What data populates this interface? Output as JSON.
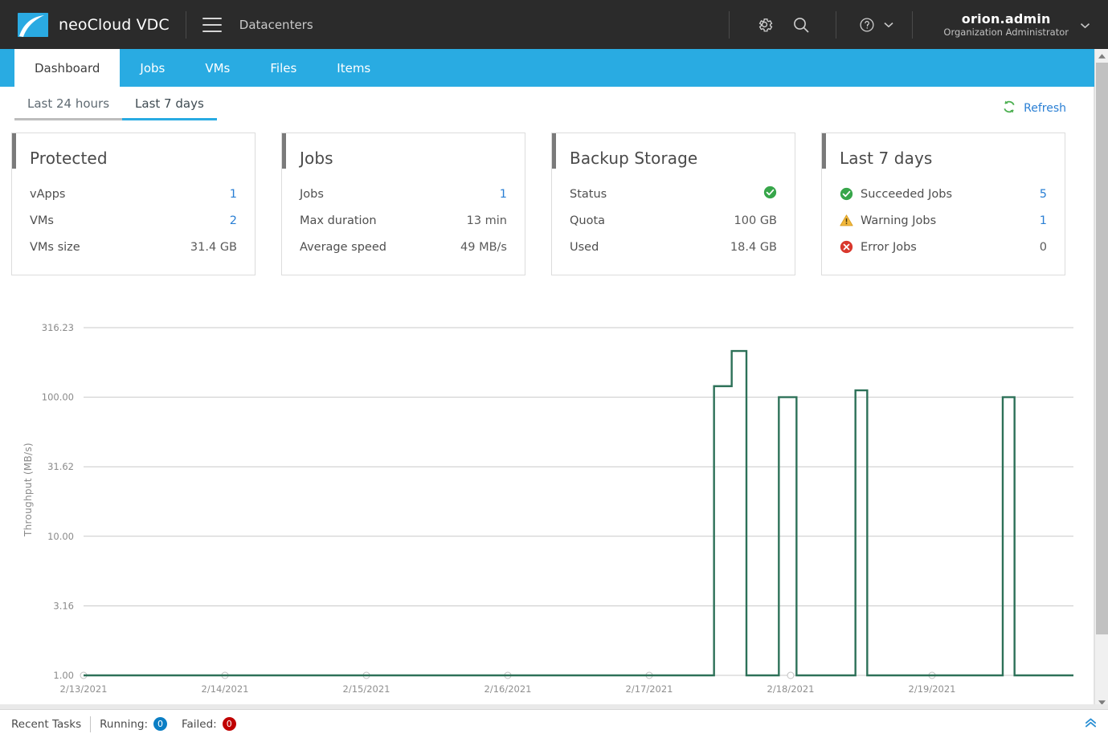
{
  "header": {
    "brand": "neoCloud VDC",
    "breadcrumb": "Datacenters",
    "menu_icon": "hamburger-icon",
    "settings_icon": "gear-icon",
    "search_icon": "search-icon",
    "help_icon": "help-circle-icon",
    "user_name": "orion.admin",
    "user_role": "Organization Administrator"
  },
  "tabs": [
    {
      "label": "Dashboard",
      "active": true
    },
    {
      "label": "Jobs",
      "active": false
    },
    {
      "label": "VMs",
      "active": false
    },
    {
      "label": "Files",
      "active": false
    },
    {
      "label": "Items",
      "active": false
    }
  ],
  "subtabs": [
    {
      "label": "Last 24 hours",
      "active": false
    },
    {
      "label": "Last 7 days",
      "active": true
    }
  ],
  "refresh": {
    "label": "Refresh",
    "icon": "refresh-icon"
  },
  "cards": [
    {
      "title": "Protected",
      "rows": [
        {
          "label": "vApps",
          "value": "1",
          "value_style": "link",
          "icon": null
        },
        {
          "label": "VMs",
          "value": "2",
          "value_style": "link",
          "icon": null
        },
        {
          "label": "VMs size",
          "value": "31.4 GB",
          "value_style": "plain",
          "icon": null
        }
      ]
    },
    {
      "title": "Jobs",
      "rows": [
        {
          "label": "Jobs",
          "value": "1",
          "value_style": "link",
          "icon": null
        },
        {
          "label": "Max duration",
          "value": "13 min",
          "value_style": "plain",
          "icon": null
        },
        {
          "label": "Average speed",
          "value": "49 MB/s",
          "value_style": "plain",
          "icon": null
        }
      ]
    },
    {
      "title": "Backup Storage",
      "rows": [
        {
          "label": "Status",
          "value": "",
          "value_style": "plain",
          "icon": null,
          "value_icon": "success-check-icon"
        },
        {
          "label": "Quota",
          "value": "100 GB",
          "value_style": "plain",
          "icon": null
        },
        {
          "label": "Used",
          "value": "18.4 GB",
          "value_style": "plain",
          "icon": null
        }
      ]
    },
    {
      "title": "Last 7 days",
      "rows": [
        {
          "label": "Succeeded Jobs",
          "value": "5",
          "value_style": "link",
          "icon": "success-check-icon"
        },
        {
          "label": "Warning Jobs",
          "value": "1",
          "value_style": "link",
          "icon": "warning-triangle-icon"
        },
        {
          "label": "Error Jobs",
          "value": "0",
          "value_style": "plain",
          "icon": "error-x-icon"
        }
      ]
    }
  ],
  "chart_data": {
    "type": "line",
    "title": "",
    "xlabel": "",
    "ylabel": "Throughput (MB/s)",
    "yscale": "log",
    "ylim": [
      1.0,
      316.23
    ],
    "ytick_labels": [
      "316.23",
      "100.00",
      "31.62",
      "10.00",
      "3.16",
      "1.00"
    ],
    "ytick_values": [
      316.23,
      100.0,
      31.62,
      10.0,
      3.16,
      1.0
    ],
    "xtick_labels": [
      "2/13/2021",
      "2/14/2021",
      "2/15/2021",
      "2/16/2021",
      "2/17/2021",
      "2/18/2021",
      "2/19/2021"
    ],
    "grid": true,
    "legend": "none",
    "series_color": "#2d7158",
    "series": [
      {
        "name": "Throughput",
        "points": [
          {
            "x": "2/13/2021 00:00",
            "y": 1.0
          },
          {
            "x": "2/17/2021 10:30",
            "y": 1.0
          },
          {
            "x": "2/17/2021 11:00",
            "y": 120.0
          },
          {
            "x": "2/17/2021 14:00",
            "y": 215.0
          },
          {
            "x": "2/17/2021 16:30",
            "y": 1.0
          },
          {
            "x": "2/17/2021 21:00",
            "y": 1.0
          },
          {
            "x": "2/17/2021 22:00",
            "y": 100.0
          },
          {
            "x": "2/18/2021 01:00",
            "y": 1.0
          },
          {
            "x": "2/18/2021 10:00",
            "y": 1.0
          },
          {
            "x": "2/18/2021 11:00",
            "y": 112.0
          },
          {
            "x": "2/18/2021 13:00",
            "y": 1.0
          },
          {
            "x": "2/19/2021 11:00",
            "y": 1.0
          },
          {
            "x": "2/19/2021 12:00",
            "y": 100.0
          },
          {
            "x": "2/19/2021 14:00",
            "y": 1.0
          },
          {
            "x": "2/20/2021 00:00",
            "y": 1.0
          }
        ]
      }
    ]
  },
  "footer": {
    "recent_tasks": "Recent Tasks",
    "running_label": "Running:",
    "running_count": "0",
    "failed_label": "Failed:",
    "failed_count": "0",
    "collapse_icon": "double-chevron-up-icon"
  },
  "colors": {
    "brand_blue": "#29abe2",
    "link_blue": "#2a7fd4",
    "topbar": "#2b2b2b",
    "success_green": "#34a853",
    "warning_amber": "#f0ad2e",
    "error_red": "#d93025",
    "chart_line": "#2d7158"
  }
}
